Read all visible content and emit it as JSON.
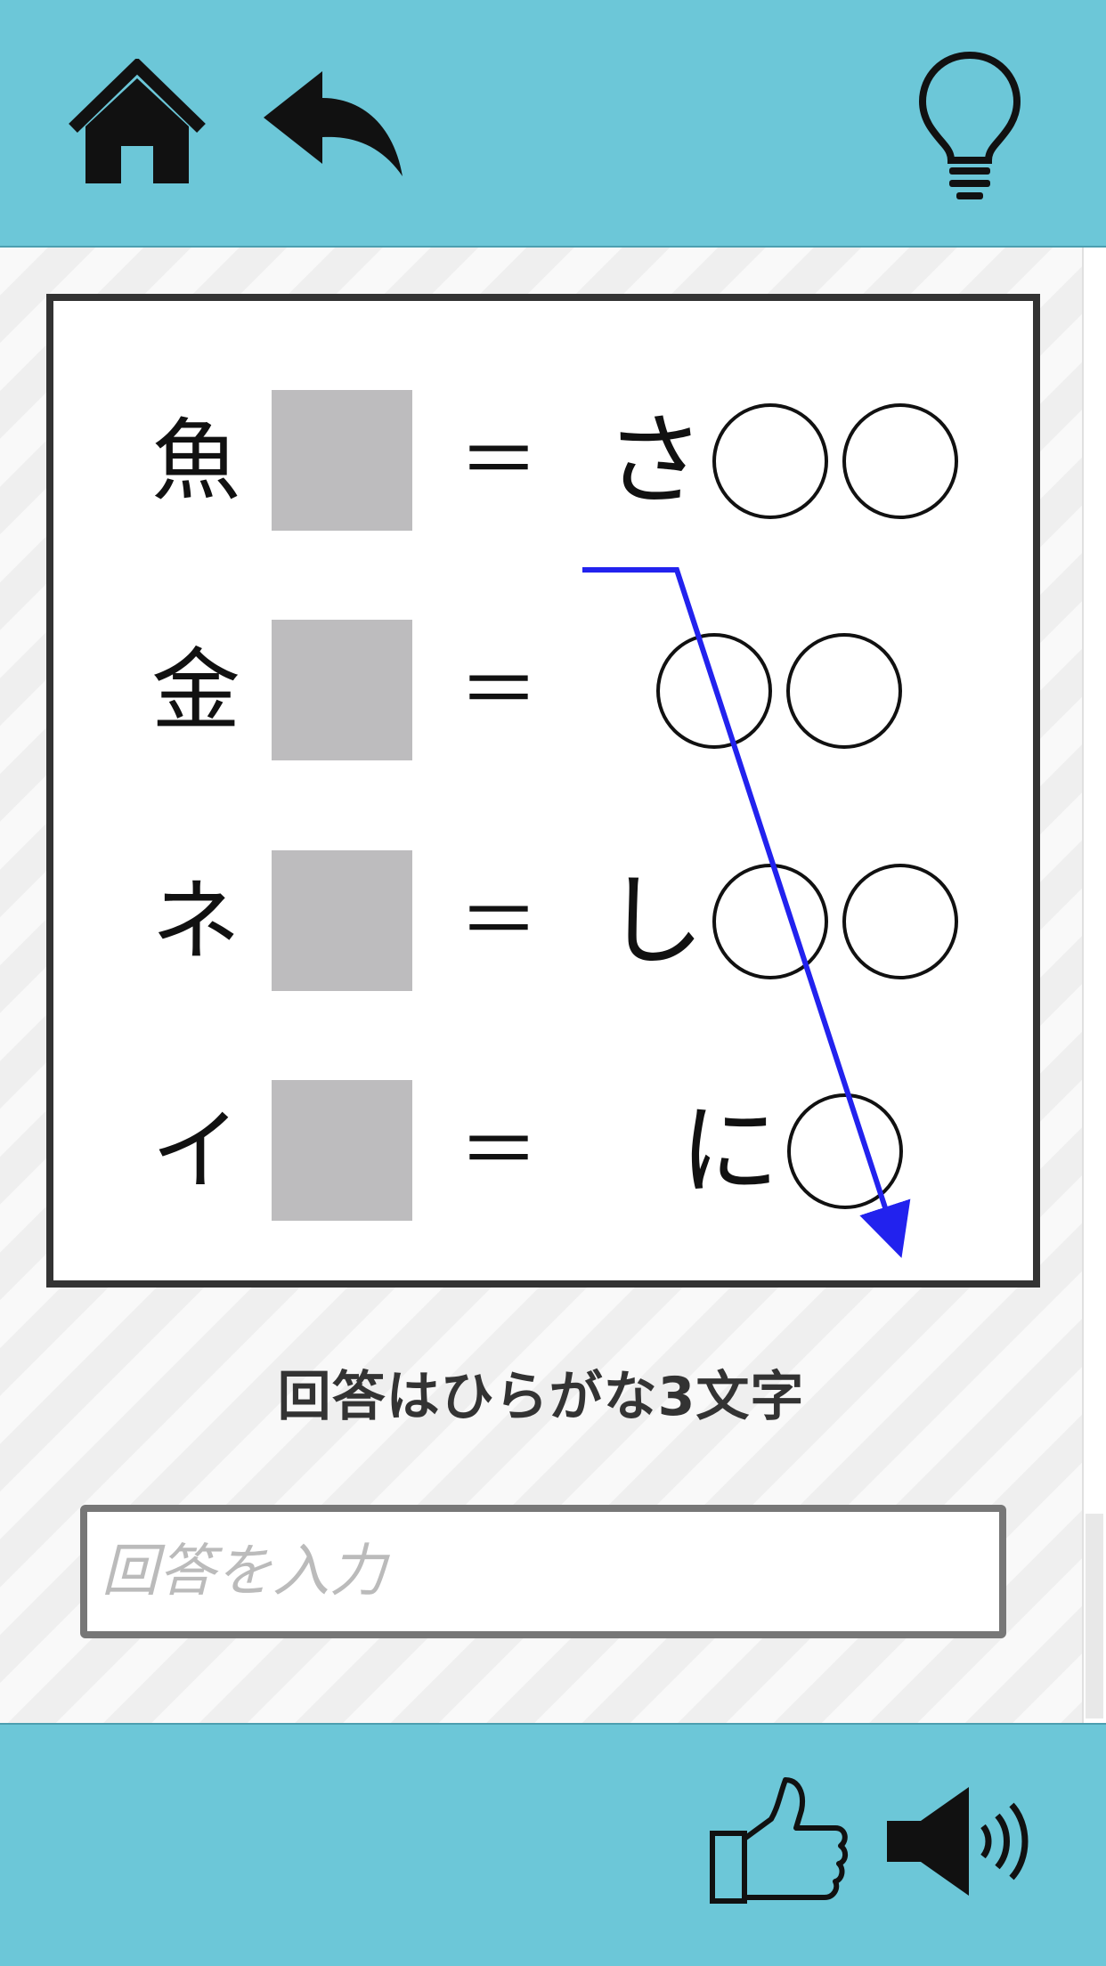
{
  "toolbar": {
    "home_icon": "home-icon",
    "back_icon": "undo-arrow-icon",
    "hint_icon": "lightbulb-icon"
  },
  "puzzle": {
    "rows": [
      {
        "lhs": "魚",
        "equals": "＝",
        "answer_prefix": "さ",
        "circles": 2
      },
      {
        "lhs": "金",
        "equals": "＝",
        "answer_prefix": "",
        "circles": 2
      },
      {
        "lhs": "ネ",
        "equals": "＝",
        "answer_prefix": "し",
        "circles": 2
      },
      {
        "lhs": "イ",
        "equals": "＝",
        "answer_prefix": "に",
        "circles": 1
      }
    ]
  },
  "answer": {
    "label": "回答はひらがな3文字",
    "placeholder": "回答を入力",
    "value": ""
  },
  "footer": {
    "like_icon": "thumbs-up-icon",
    "sound_icon": "speaker-icon"
  },
  "colors": {
    "bar": "#6cc7d8",
    "blank": "#bdbcbe",
    "hint_line": "#2222ee"
  }
}
